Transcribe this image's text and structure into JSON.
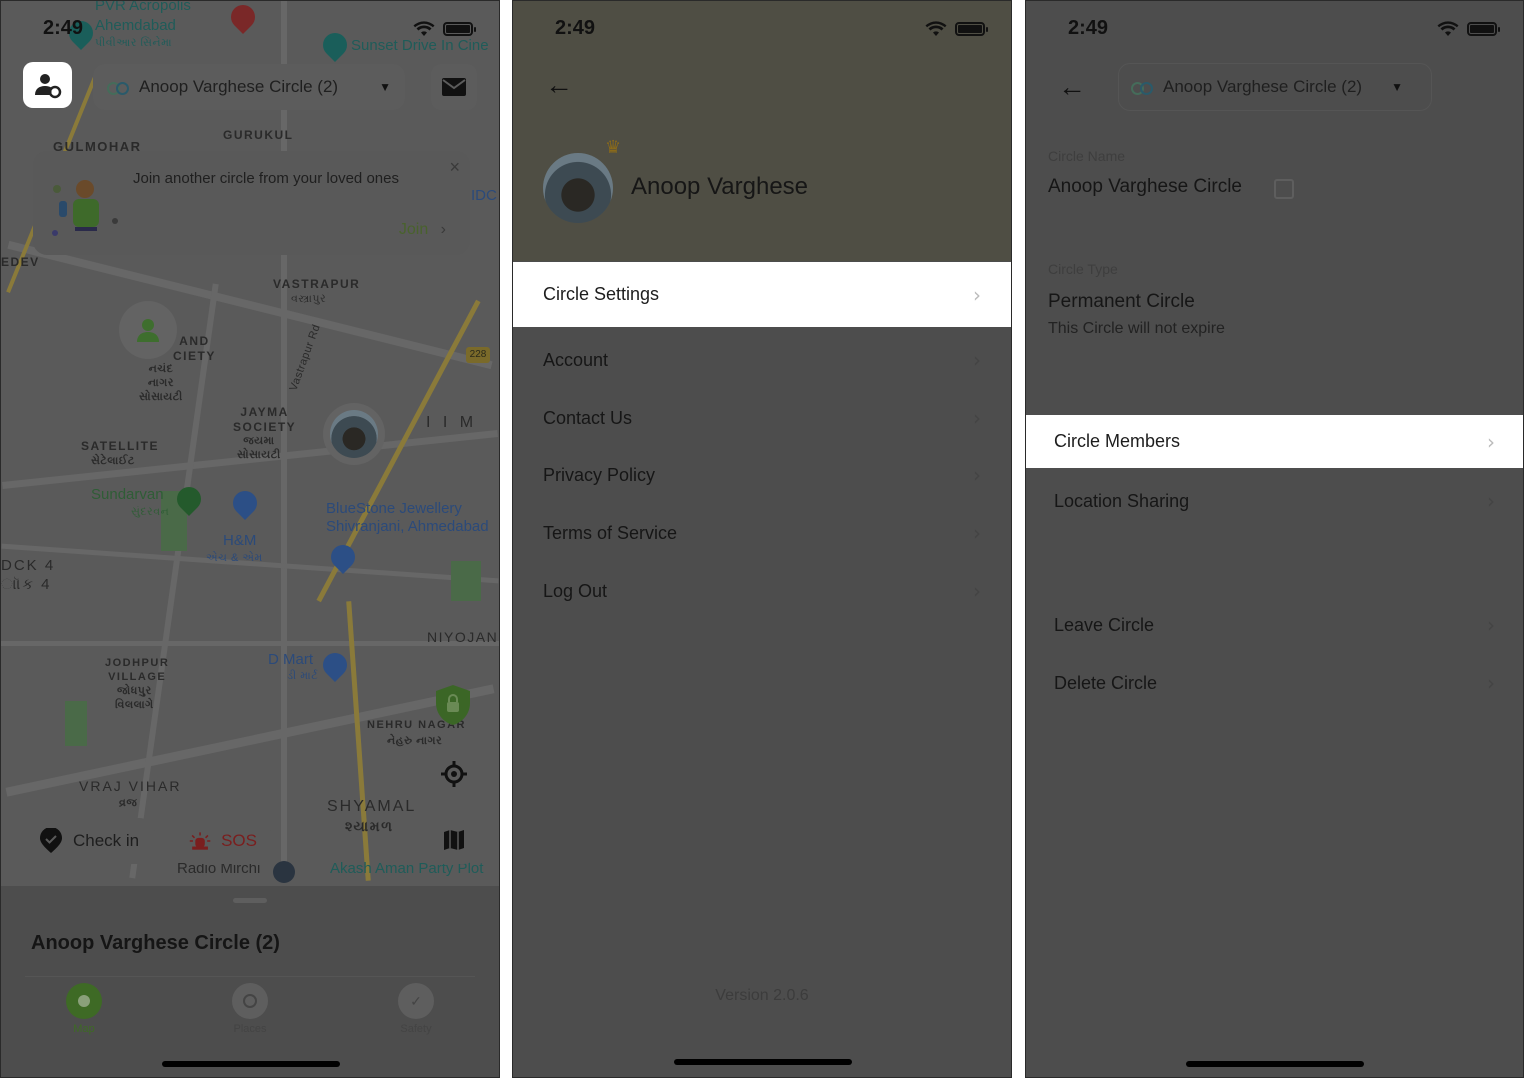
{
  "status_bar": {
    "time": "2:49"
  },
  "panel_map": {
    "circle_selector": {
      "label": "Anoop Varghese Circle (2)"
    },
    "join_card": {
      "message": "Join another circle from your loved ones",
      "join_label": "Join",
      "close_label": "×"
    },
    "map_labels": {
      "pvr": "PVR Acropolis",
      "ahemdabad": "Ahemdabad",
      "ahemdabad_gu": "પીવીઆર સિનેમા",
      "sunset": "Sunset Drive In Cine",
      "gurukul": "GURUKUL",
      "gulmohar": "GULMOHAR",
      "vastrapur": "VASTRAPUR",
      "vastrapur_gu": "વસ્ત્રાપુર",
      "vastrapur_rd": "Vastrapur Rd",
      "society": "AND\nCIETY",
      "society_gu": "નચંદ\nનાગર\nસોસાયટી",
      "jayma": "JAYMA\nSOCIETY",
      "jayma_gu": "જયમા\nસોસાયટી",
      "satellite": "SATELLITE",
      "satellite_gu": "સેટેલાઈટ",
      "iim": "I I M",
      "hwy": "228",
      "sundarvan": "Sundarvan",
      "sundarvan_gu": "સુંદરવન",
      "hm": "H&M",
      "hm_gu": "એચ & એમ",
      "bluestone": "BlueStone Jewellery\nShivranjani, Ahmedabad",
      "block": "DCK 4\nાૉક 4",
      "niyojan": "NIYOJAN",
      "dmart": "D Mart",
      "dmart_gu": "ડી માર્ટ",
      "jodhpur": "JODHPUR\nVILLAGE",
      "jodhpur_gu": "જોધપુર\nવિલલાગે",
      "nehru": "NEHRU NAGAR",
      "nehru_gu": "નેહરુ નાગર",
      "vraj": "VRAJ VIHAR",
      "vraj_gu": "વ્રજ",
      "shyamal": "SHYAMAL",
      "shyamal_gu": "શ્યામળ",
      "radio": "Radio Mirchi",
      "akash": "Akash Aman Party Plot",
      "edev": "EDEV",
      "idc": "IDC"
    },
    "check_in_label": "Check in",
    "sos_label": "SOS",
    "sheet_title": "Anoop Varghese Circle (2)",
    "tabs": [
      {
        "label": "Map",
        "active": true
      },
      {
        "label": "Places",
        "active": false
      },
      {
        "label": "Safety",
        "active": false
      }
    ],
    "colors": {
      "accent_green": "#4a7a2a",
      "sos_red": "#8a2222"
    }
  },
  "panel_profile": {
    "user_name": "Anoop Varghese",
    "menu": [
      {
        "label": "Circle Settings",
        "highlighted": true
      },
      {
        "label": "Account"
      },
      {
        "label": "Contact Us"
      },
      {
        "label": "Privacy Policy"
      },
      {
        "label": "Terms of Service"
      },
      {
        "label": "Log Out"
      }
    ],
    "version": "Version 2.0.6"
  },
  "panel_circle_settings": {
    "circle_selector": {
      "label": "Anoop Varghese Circle (2)"
    },
    "circle_name_label": "Circle Name",
    "circle_name": "Anoop Varghese Circle",
    "circle_type_label": "Circle Type",
    "circle_type": "Permanent Circle",
    "circle_type_desc": "This Circle will not expire",
    "menu": [
      {
        "label": "Circle Members",
        "highlighted": true
      },
      {
        "label": "Location Sharing"
      },
      {
        "label": "Leave Circle"
      },
      {
        "label": "Delete Circle"
      }
    ]
  }
}
